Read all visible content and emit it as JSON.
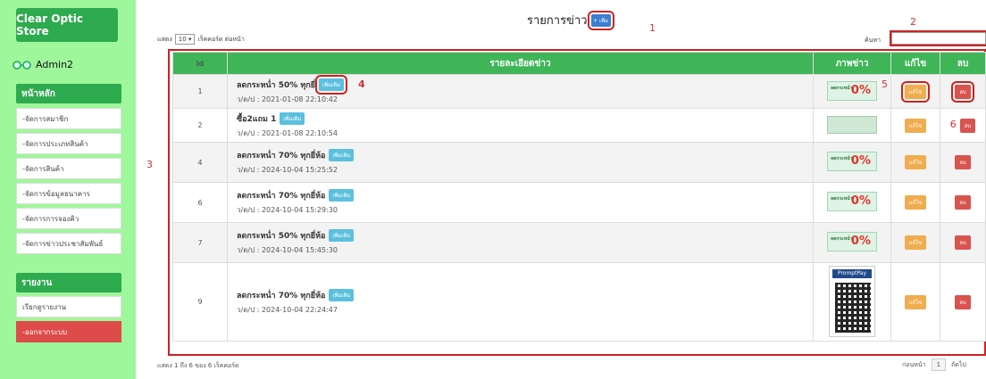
{
  "sidebar": {
    "store_name": "Clear Optic Store",
    "user": "Admin2",
    "main_header": "หน้าหลัก",
    "items": [
      {
        "label": "-จัดการสมาชิก"
      },
      {
        "label": "-จัดการประเภทสินค้า"
      },
      {
        "label": "-จัดการสินค้า"
      },
      {
        "label": "-จัดการข้อมูลธนาคาร"
      },
      {
        "label": "-จัดการการจองคิว"
      },
      {
        "label": "-จัดการข่าวประชาสัมพันธ์"
      }
    ],
    "report_header": "รายงาน",
    "report_item": "เรียกดูรายงาน",
    "logout": "-ออกจากระบบ"
  },
  "header": {
    "title": "รายการข่าว",
    "add_label": "+ เพิ่ม"
  },
  "controls": {
    "show_prefix": "แสดง",
    "page_size": "10",
    "show_suffix": "เร็คคอร์ด ต่อหน้า",
    "search_label": "ค้นหา"
  },
  "annotations": {
    "n1": "1",
    "n2": "2",
    "n3": "3",
    "n4": "4",
    "n5": "5",
    "n6": "6"
  },
  "table": {
    "headers": {
      "id": "id",
      "detail": "รายละเอียดข่าว",
      "image": "ภาพข่าว",
      "edit": "แก้ไข",
      "delete": "ลบ"
    },
    "more_label": "เพิ่มเติม",
    "edit_label": "แก้ไข",
    "delete_label": "ลบ",
    "rows": [
      {
        "id": "1",
        "title": "ลดกระหน่ำ 50% ทุกยี่",
        "date": "ว/ด/ป : 2021-01-08 22:10:42"
      },
      {
        "id": "2",
        "title": "ซื้อ2แถม 1",
        "date": "ว/ด/ป : 2021-01-08 22:10:54"
      },
      {
        "id": "4",
        "title": "ลดกระหน่ำ 70% ทุกยี่ห้อ",
        "date": "ว/ด/ป : 2024-10-04 15:25:52"
      },
      {
        "id": "6",
        "title": "ลดกระหน่ำ 70% ทุกยี่ห้อ",
        "date": "ว/ด/ป : 2024-10-04 15:29:30"
      },
      {
        "id": "7",
        "title": "ลดกระหน่ำ 50% ทุกยี่ห้อ",
        "date": "ว/ด/ป : 2024-10-04 15:45:30"
      },
      {
        "id": "9",
        "title": "ลดกระหน่ำ 70% ทุกยี่ห้อ",
        "date": "ว/ด/ป : 2024-10-04 22:24:47"
      }
    ],
    "thumb_text": "ลดกระหน่ำ",
    "thumb_big": "0%",
    "promptpay": "PromptPay"
  },
  "footer": {
    "summary": "แสดง 1 ถึง 6 ของ 6 เร็คคอร์ด",
    "prev": "ก่อนหน้า",
    "page": "1",
    "next": "ถัดไป"
  },
  "colors": {
    "sidebar_bg": "#9ef79a",
    "primary_green": "#2eaa4f",
    "table_header": "#3fb558",
    "highlight_red": "#cc2222"
  }
}
